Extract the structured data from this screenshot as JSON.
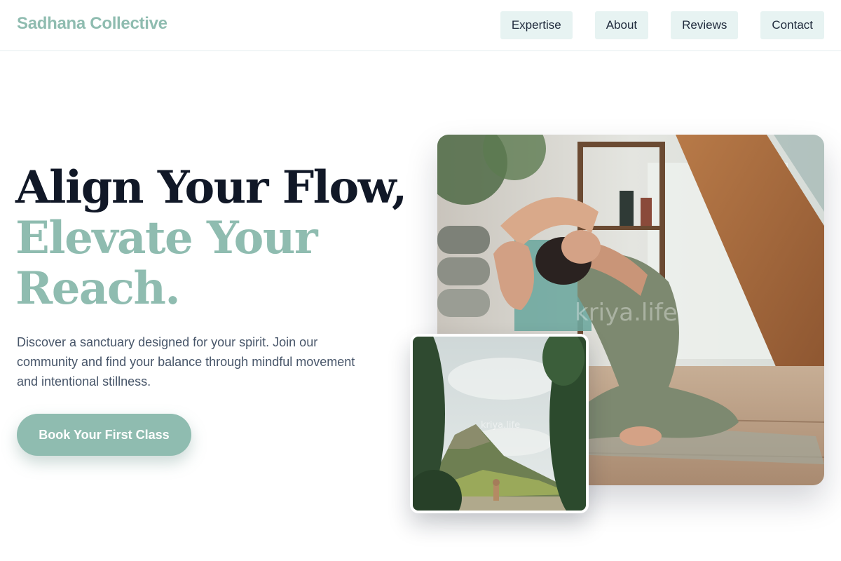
{
  "header": {
    "brand": "Sadhana Collective",
    "nav": [
      {
        "label": "Expertise"
      },
      {
        "label": "About"
      },
      {
        "label": "Reviews"
      },
      {
        "label": "Contact"
      }
    ]
  },
  "hero": {
    "headline_line1": "Align Your Flow,",
    "headline_line2": "Elevate Your Reach.",
    "description": "Discover a sanctuary designed for your spirit. Join our community and find your balance through mindful movement and intentional stillness.",
    "cta_label": "Book Your First Class"
  },
  "images": {
    "main_watermark": "kriya.life",
    "inset_watermark": "kriya.life"
  },
  "colors": {
    "accent": "#8fbcb0",
    "nav_bg": "#e7f3f2",
    "heading_dark": "#111827",
    "body_text": "#475569"
  }
}
